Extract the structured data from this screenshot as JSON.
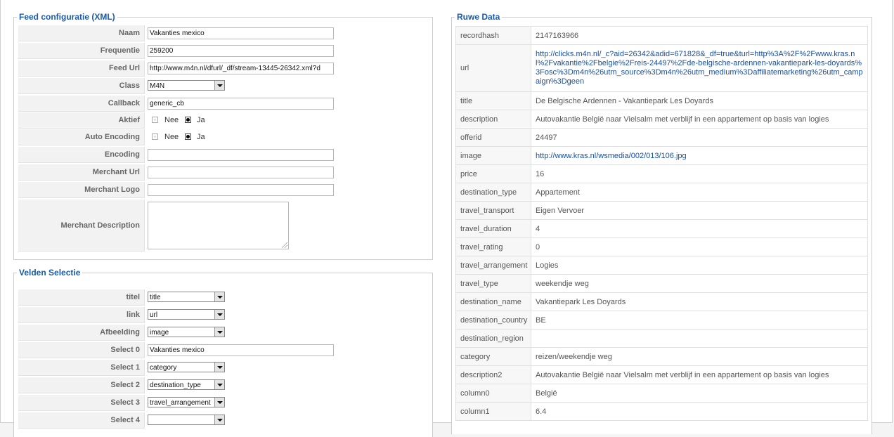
{
  "feed_config": {
    "title": "Feed configuratie (XML)",
    "naam_label": "Naam",
    "naam_value": "Vakanties mexico",
    "frequentie_label": "Frequentie",
    "frequentie_value": "259200",
    "feed_url_label": "Feed Url",
    "feed_url_value": "http://www.m4n.nl/dfurl/_df/stream-13445-26342.xml?d",
    "class_label": "Class",
    "class_value": "M4N",
    "callback_label": "Callback",
    "callback_value": "generic_cb",
    "aktief_label": "Aktief",
    "aktief_no": "Nee",
    "aktief_yes": "Ja",
    "auto_encoding_label": "Auto Encoding",
    "auto_encoding_no": "Nee",
    "auto_encoding_yes": "Ja",
    "encoding_label": "Encoding",
    "encoding_value": "",
    "merchant_url_label": "Merchant Url",
    "merchant_url_value": "",
    "merchant_logo_label": "Merchant Logo",
    "merchant_logo_value": "",
    "merchant_description_label": "Merchant Description",
    "merchant_description_value": ""
  },
  "field_selection": {
    "title": "Velden Selectie",
    "rows": [
      {
        "label": "titel",
        "value": "title",
        "kind": "select"
      },
      {
        "label": "link",
        "value": "url",
        "kind": "select"
      },
      {
        "label": "Afbeelding",
        "value": "image",
        "kind": "select"
      },
      {
        "label": "Select 0",
        "value": "Vakanties mexico",
        "kind": "input"
      },
      {
        "label": "Select 1",
        "value": "category",
        "kind": "select"
      },
      {
        "label": "Select 2",
        "value": "destination_type",
        "kind": "select"
      },
      {
        "label": "Select 3",
        "value": "travel_arrangement",
        "kind": "select"
      },
      {
        "label": "Select 4",
        "value": "",
        "kind": "select"
      }
    ]
  },
  "raw_data": {
    "title": "Ruwe Data",
    "rows": [
      {
        "key": "recordhash",
        "value": "2147163966"
      },
      {
        "key": "url",
        "value": "http://clicks.m4n.nl/_c?aid=26342&adid=671828&_df=true&turl=http%3A%2F%2Fwww.kras.nl%2Fvakantie%2Fbelgie%2Freis-24497%2Fde-belgische-ardennen-vakantiepark-les-doyards%3Fosc%3Dm4n%26utm_source%3Dm4n%26utm_medium%3Daffiliatemarketing%26utm_campaign%3Dgeen",
        "link": true
      },
      {
        "key": "title",
        "value": "De Belgische Ardennen - Vakantiepark Les Doyards"
      },
      {
        "key": "description",
        "value": "Autovakantie België naar Vielsalm met verblijf in een appartement op basis van logies"
      },
      {
        "key": "offerid",
        "value": "24497"
      },
      {
        "key": "image",
        "value": "http://www.kras.nl/wsmedia/002/013/106.jpg",
        "link": true
      },
      {
        "key": "price",
        "value": "16"
      },
      {
        "key": "destination_type",
        "value": "Appartement"
      },
      {
        "key": "travel_transport",
        "value": "Eigen Vervoer"
      },
      {
        "key": "travel_duration",
        "value": "4"
      },
      {
        "key": "travel_rating",
        "value": "0"
      },
      {
        "key": "travel_arrangement",
        "value": "Logies"
      },
      {
        "key": "travel_type",
        "value": "weekendje weg"
      },
      {
        "key": "destination_name",
        "value": "Vakantiepark Les Doyards"
      },
      {
        "key": "destination_country",
        "value": "BE"
      },
      {
        "key": "destination_region",
        "value": ""
      },
      {
        "key": "category",
        "value": "reizen/weekendje weg"
      },
      {
        "key": "description2",
        "value": "Autovakantie België naar Vielsalm met verblijf in een appartement op basis van logies"
      },
      {
        "key": "column0",
        "value": "België"
      },
      {
        "key": "column1",
        "value": "6.4"
      }
    ]
  },
  "colors": {
    "accent": "#1a5aa8",
    "link": "#1a4fa0",
    "label_bg": "#f2f2f2"
  }
}
